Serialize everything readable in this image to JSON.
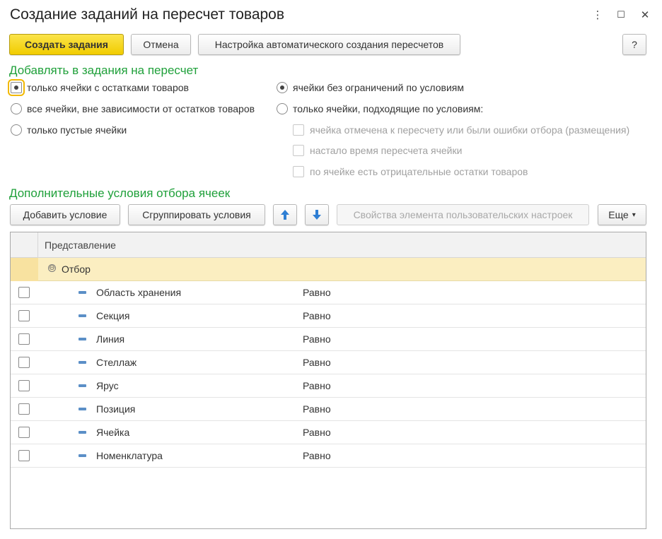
{
  "window": {
    "title": "Создание заданий на пересчет товаров",
    "controls": {
      "more": "⋮",
      "maximize": "☐",
      "close": "✕"
    }
  },
  "toolbar": {
    "create_label": "Создать задания",
    "cancel_label": "Отмена",
    "auto_settings_label": "Настройка автоматического создания пересчетов",
    "help_label": "?"
  },
  "add_section": {
    "title": "Добавлять в задания на пересчет",
    "stock_options": [
      {
        "label": "только ячейки с остатками товаров",
        "selected": true
      },
      {
        "label": "все ячейки, вне зависимости от остатков товаров",
        "selected": false
      },
      {
        "label": "только пустые ячейки",
        "selected": false
      }
    ],
    "condition_options": [
      {
        "label": "ячейки без ограничений по условиям",
        "selected": true
      },
      {
        "label": "только ячейки, подходящие по условиям:",
        "selected": false
      }
    ],
    "condition_checkboxes": [
      {
        "label": "ячейка отмечена к пересчету или были ошибки отбора (размещения)",
        "checked": false,
        "enabled": false
      },
      {
        "label": "настало время пересчета ячейки",
        "checked": false,
        "enabled": false
      },
      {
        "label": "по ячейке есть отрицательные остатки товаров",
        "checked": false,
        "enabled": false
      }
    ]
  },
  "filter_section": {
    "title": "Дополнительные условия отбора ячеек",
    "add_condition_label": "Добавить условие",
    "group_conditions_label": "Сгруппировать условия",
    "move_up_icon": "arrow-up-icon",
    "move_down_icon": "arrow-down-icon",
    "properties_label": "Свойства элемента пользовательских настроек",
    "more_label": "Еще",
    "more_caret": "▾"
  },
  "grid": {
    "column_header": "Представление",
    "group": {
      "toggle": "⊖",
      "label": "Отбор"
    },
    "rows": [
      {
        "field": "Область хранения",
        "condition": "Равно",
        "checked": false
      },
      {
        "field": "Секция",
        "condition": "Равно",
        "checked": false
      },
      {
        "field": "Линия",
        "condition": "Равно",
        "checked": false
      },
      {
        "field": "Стеллаж",
        "condition": "Равно",
        "checked": false
      },
      {
        "field": "Ярус",
        "condition": "Равно",
        "checked": false
      },
      {
        "field": "Позиция",
        "condition": "Равно",
        "checked": false
      },
      {
        "field": "Ячейка",
        "condition": "Равно",
        "checked": false
      },
      {
        "field": "Номенклатура",
        "condition": "Равно",
        "checked": false
      }
    ]
  },
  "colors": {
    "primary_button": "#f5d31c",
    "section_title": "#1fa03a",
    "group_row_bg": "#fbeec1",
    "arrow_icon": "#2f7fd4"
  }
}
